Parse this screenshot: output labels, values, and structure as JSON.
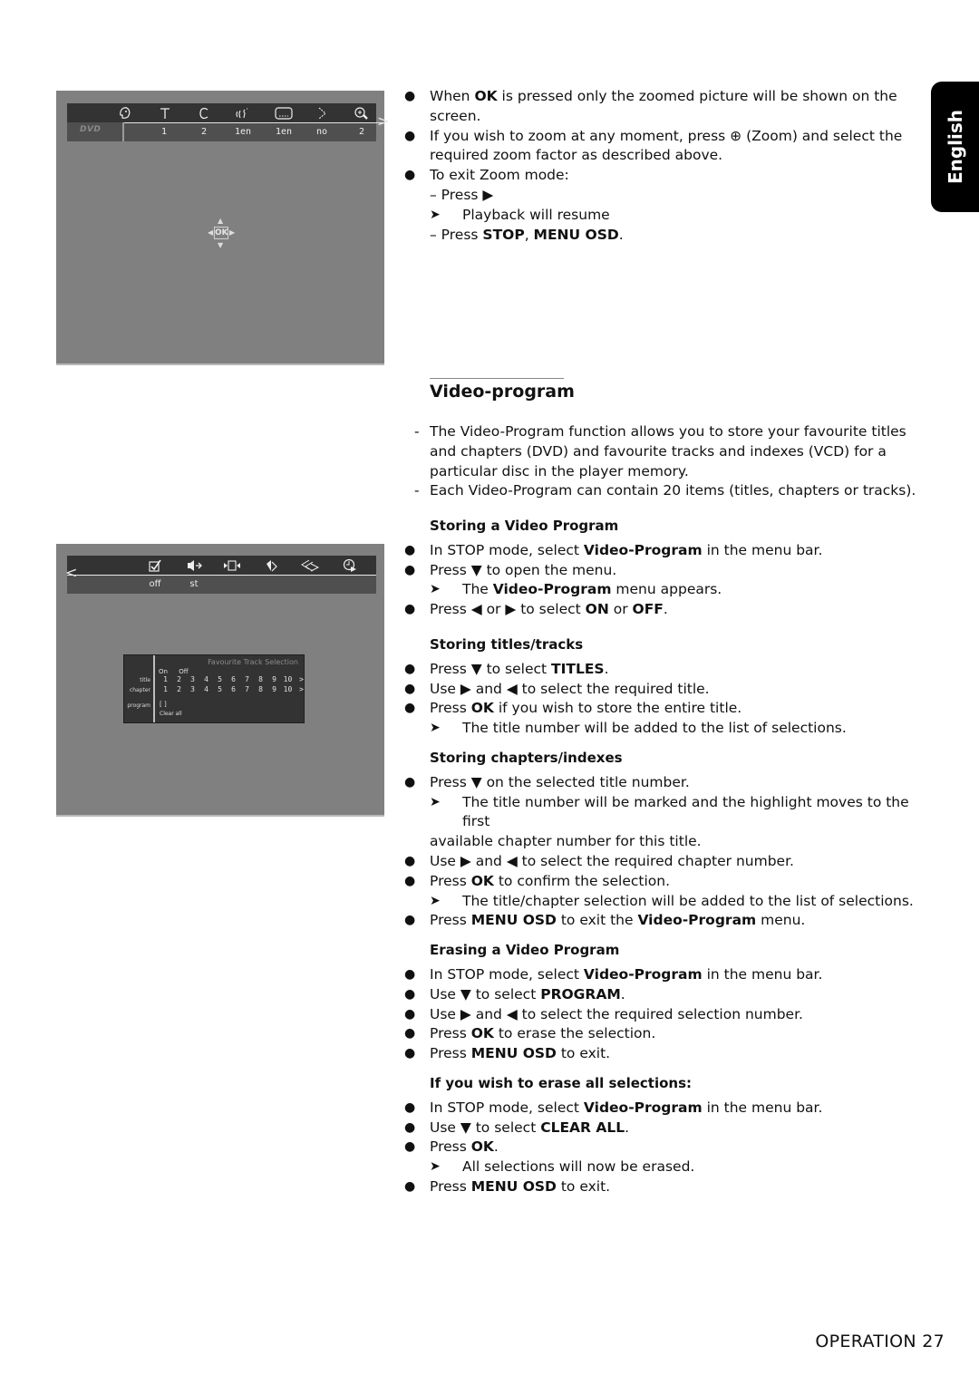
{
  "language_tab": "English",
  "osd_zoom": {
    "logo": "DVD",
    "menu_icons": [
      "user-preferences-icon",
      "title-icon",
      "chapter-icon",
      "audio-language-icon",
      "subtitle-icon",
      "angle-icon",
      "zoom-icon"
    ],
    "menu_values": [
      "1",
      "2",
      "1en",
      "1en",
      "no",
      "2"
    ],
    "ok_label": "OK"
  },
  "osd_video_program": {
    "menu_icons": [
      "video-program-icon",
      "sound-icon",
      "frame-by-frame-icon",
      "slow-motion-icon",
      "fast-motion-icon",
      "time-search-icon"
    ],
    "menu_values": [
      "off",
      "st"
    ],
    "panel": {
      "title": "Favourite Track Selection",
      "on_label": "On",
      "off_label": "Off",
      "title_label": "title",
      "chapter_label": "chapter",
      "program_label": "program",
      "title_numbers": [
        "1",
        "2",
        "3",
        "4",
        "5",
        "6",
        "7",
        "8",
        "9",
        "10"
      ],
      "chapter_numbers": [
        "1",
        "2",
        "3",
        "4",
        "5",
        "6",
        "7",
        "8",
        "9",
        "10"
      ],
      "program_value": "[ ]",
      "clear_all": "Clear all"
    }
  },
  "intro": [
    {
      "type": "bullet",
      "html": "When <b>OK</b> is pressed only the zoomed picture will be shown on the screen."
    },
    {
      "type": "bullet",
      "html": "If you wish to zoom at any moment, press <span class='zoom-glyph'>⊕</span> (Zoom) and select the required zoom factor as described above."
    },
    {
      "type": "bullet",
      "html": "To exit Zoom mode:"
    },
    {
      "type": "sub",
      "html": "– Press ▶"
    },
    {
      "type": "arrow",
      "html": "Playback will resume"
    },
    {
      "type": "sub",
      "html": "– Press <b>STOP</b>, <b>MENU OSD</b>."
    }
  ],
  "section_title": "Video-program",
  "description": [
    {
      "type": "dash",
      "html": "The Video-Program function allows you to store your favourite titles and chapters (DVD) and favourite tracks and indexes (VCD) for a particular disc in the player memory."
    },
    {
      "type": "dash",
      "html": "Each Video-Program can contain 20 items (titles, chapters or tracks)."
    }
  ],
  "subsections": [
    {
      "heading": "Storing a Video Program",
      "items": [
        {
          "type": "bullet",
          "html": "In STOP mode, select <b>Video-Program</b> in the menu bar."
        },
        {
          "type": "bullet",
          "html": "Press ▼ to open the menu."
        },
        {
          "type": "arrow",
          "html": "The <b>Video-Program</b> menu appears."
        },
        {
          "type": "bullet",
          "html": "Press ◀ or ▶ to select <b>ON</b> or <b>OFF</b>."
        }
      ]
    },
    {
      "heading": "Storing titles/tracks",
      "items": [
        {
          "type": "bullet",
          "html": "Press ▼ to select <b>TITLES</b>."
        },
        {
          "type": "bullet",
          "html": "Use ▶ and ◀ to select the required title."
        },
        {
          "type": "bullet",
          "html": "Press <b>OK</b> if you wish to store the entire title."
        },
        {
          "type": "arrow",
          "html": "The title number will be added to the list of selections."
        }
      ]
    },
    {
      "heading": "Storing chapters/indexes",
      "items": [
        {
          "type": "bullet",
          "html": "Press ▼ on the selected title number."
        },
        {
          "type": "arrow",
          "html": "The title number will be marked and the highlight moves to the first"
        },
        {
          "type": "cont",
          "html": "available chapter number for this title."
        },
        {
          "type": "bullet",
          "html": "Use ▶ and ◀ to select the required chapter number."
        },
        {
          "type": "bullet",
          "html": "Press <b>OK</b> to confirm the selection."
        },
        {
          "type": "arrow",
          "html": "The title/chapter selection will be added to the list of selections."
        },
        {
          "type": "bullet",
          "html": "Press <b>MENU OSD</b> to exit the <b>Video-Program</b> menu."
        }
      ]
    },
    {
      "heading": "Erasing a Video Program",
      "items": [
        {
          "type": "bullet",
          "html": "In STOP mode, select <b>Video-Program</b> in the menu bar."
        },
        {
          "type": "bullet",
          "html": "Use ▼ to select <b>PROGRAM</b>."
        },
        {
          "type": "bullet",
          "html": "Use ▶ and ◀ to select the required selection number."
        },
        {
          "type": "bullet",
          "html": "Press <b>OK</b> to erase the selection."
        },
        {
          "type": "bullet",
          "html": "Press <b>MENU OSD</b> to exit."
        }
      ]
    },
    {
      "heading": "If you wish to erase all selections:",
      "items": [
        {
          "type": "bullet",
          "html": "In STOP mode, select <b>Video-Program</b> in the menu bar."
        },
        {
          "type": "bullet",
          "html": "Use ▼ to select <b>CLEAR ALL</b>."
        },
        {
          "type": "bullet",
          "html": "Press <b>OK</b>."
        },
        {
          "type": "arrow",
          "html": "All selections will now be erased."
        },
        {
          "type": "bullet",
          "html": "Press <b>MENU OSD</b> to exit."
        }
      ]
    }
  ],
  "footer": "OPERATION 27"
}
